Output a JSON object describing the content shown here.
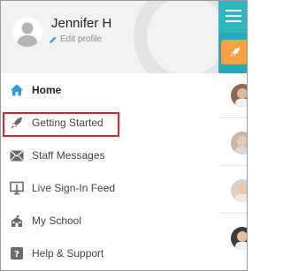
{
  "profile": {
    "name": "Jennifer H",
    "edit_label": "Edit profile"
  },
  "menu": {
    "items": [
      {
        "label": "Home",
        "icon": "home-icon",
        "active": true
      },
      {
        "label": "Getting Started",
        "icon": "rocket-icon",
        "active": false,
        "highlighted": true
      },
      {
        "label": "Staff Messages",
        "icon": "envelope-icon",
        "active": false
      },
      {
        "label": "Live Sign-In Feed",
        "icon": "sign-in-feed-icon",
        "active": false
      },
      {
        "label": "My School",
        "icon": "school-icon",
        "active": false
      },
      {
        "label": "Help & Support",
        "icon": "help-icon",
        "active": false
      }
    ]
  },
  "colors": {
    "accent_teal": "#2fb6c1",
    "accent_orange": "#f4a340",
    "highlight_red": "#d9252c"
  },
  "background_app": {
    "header_icon": "hamburger-icon",
    "tab_icon": "rocket-icon"
  }
}
